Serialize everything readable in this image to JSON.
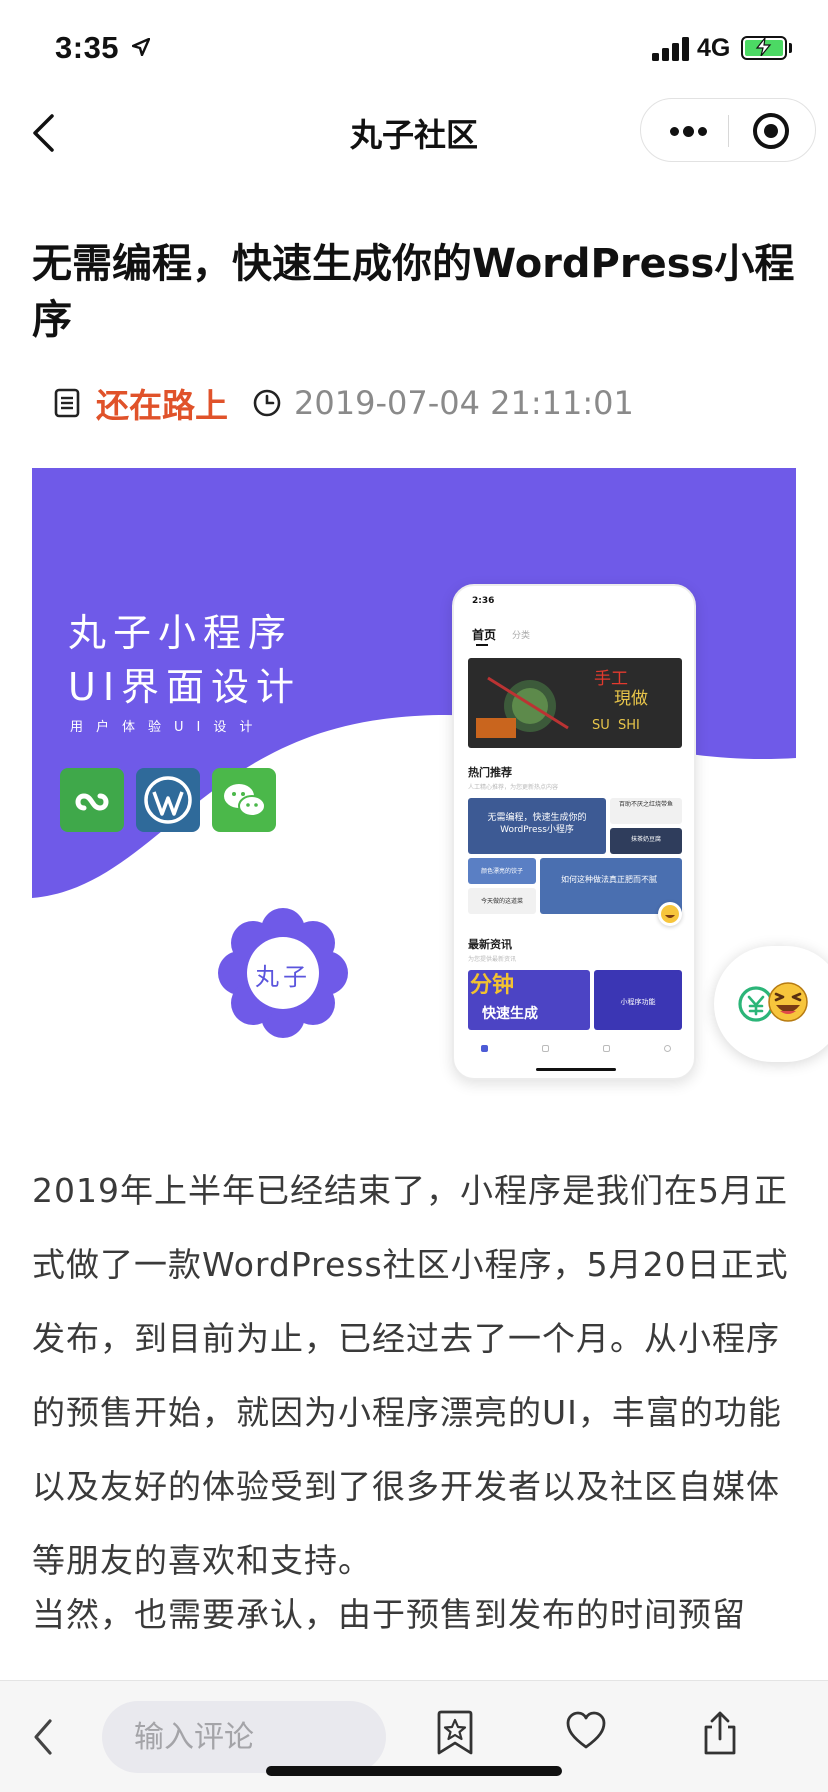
{
  "status_bar": {
    "time": "3:35",
    "network": "4G"
  },
  "nav": {
    "title": "丸子社区"
  },
  "article": {
    "title": "无需编程，快速生成你的WordPress小程序",
    "author": "还在路上",
    "date": "2019-07-04 21:11:01",
    "paragraphs": [
      "2019年上半年已经结束了，小程序是我们在5月正式做了一款WordPress社区小程序，5月20日正式发布，到目前为止，已经过去了一个月。从小程序的预售开始，就因为小程序漂亮的UI，丰富的功能以及友好的体验受到了很多开发者以及社区自媒体等朋友的喜欢和支持。",
      "当然，也需要承认，由于预售到发布的时间预留"
    ]
  },
  "hero": {
    "title_line1": "丸子小程序",
    "title_line2": "UI界面设计",
    "subtitle": "用户体验UI设计",
    "badge": "丸子",
    "phone": {
      "time": "2:36",
      "tab_home": "首页",
      "tab_category": "分类",
      "banner_line1": "手工",
      "banner_line2": "現做",
      "banner_sushi": "SU  SHI",
      "section_hot": "热门推荐",
      "section_hot_sub": "人工精心推荐，为您更新热点内容",
      "card_main": "无需编程，快速生成你的WordPress小程序",
      "card_side1": "百助不厌之红烧带鱼",
      "card_side2": "抹茶奶豆腐",
      "card_small1": "颜色漂亮的饺子",
      "card_small2": "今天做的这道菜",
      "card_diet": "如何这种做法真正肥而不腻",
      "section_news": "最新资讯",
      "section_news_sub": "为您提供最新资讯",
      "news_card1_big": "分钟",
      "news_card1_small": "快速生成",
      "news_card2": "小程序功能"
    }
  },
  "bottom_bar": {
    "comment_placeholder": "输入评论"
  },
  "colors": {
    "author": "#e0522a",
    "hero_purple": "#6f5ae8",
    "battery": "#4cd964"
  }
}
